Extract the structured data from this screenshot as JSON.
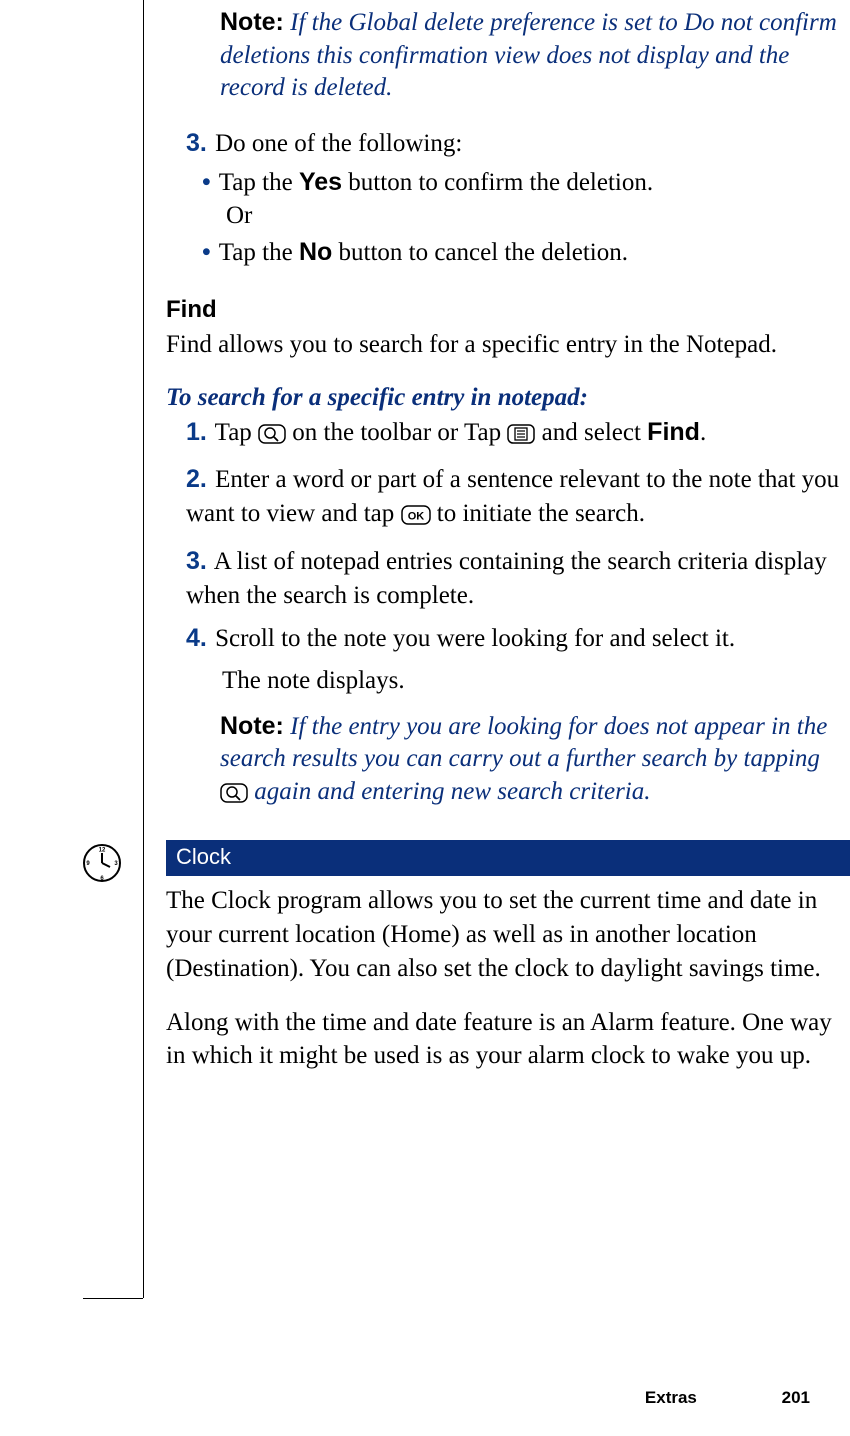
{
  "note1": {
    "label": "Note:",
    "text": "If the Global delete preference is set to Do not confirm deletions this confirmation view does not display and the record is deleted."
  },
  "step3": {
    "num": "3.",
    "text": "Do one of the following:",
    "bullet1a": "Tap the ",
    "yes": "Yes",
    "bullet1b": " button to confirm the deletion.",
    "or": "Or",
    "bullet2a": "Tap the ",
    "no": "No",
    "bullet2b": " button to cancel the deletion."
  },
  "find": {
    "heading": "Find",
    "para": "Find allows you to search for a specific entry in the Notepad."
  },
  "search": {
    "heading": "To search for a specific entry in notepad:",
    "s1": {
      "num": "1.",
      "a": "Tap ",
      "b": " on the toolbar or Tap ",
      "c": " and select ",
      "find": "Find",
      "d": "."
    },
    "s2": {
      "num": "2.",
      "a": "Enter a word or part of a sentence relevant to the note that you want to view and tap ",
      "b": " to initiate the search."
    },
    "s3": {
      "num": "3.",
      "text": "A list of notepad entries containing the search criteria display when the search is complete."
    },
    "s4": {
      "num": "4.",
      "text": "Scroll to the note you were looking for and select it.",
      "text2": "The note displays."
    }
  },
  "note2": {
    "label": "Note:",
    "a": "If the entry you are looking for does not appear in the search results you can carry out a further search by tapping ",
    "b": " again and entering new search criteria."
  },
  "clock": {
    "heading": "Clock",
    "p1": "The Clock program allows you to set the current time and date in your current location (Home) as well as in another location (Destination). You can also set the clock to daylight savings time.",
    "p2": "Along with the time and date feature is an Alarm feature. One way in which it might be used is as your alarm clock to wake you up."
  },
  "footer": {
    "chapter": "Extras",
    "page": "201"
  }
}
